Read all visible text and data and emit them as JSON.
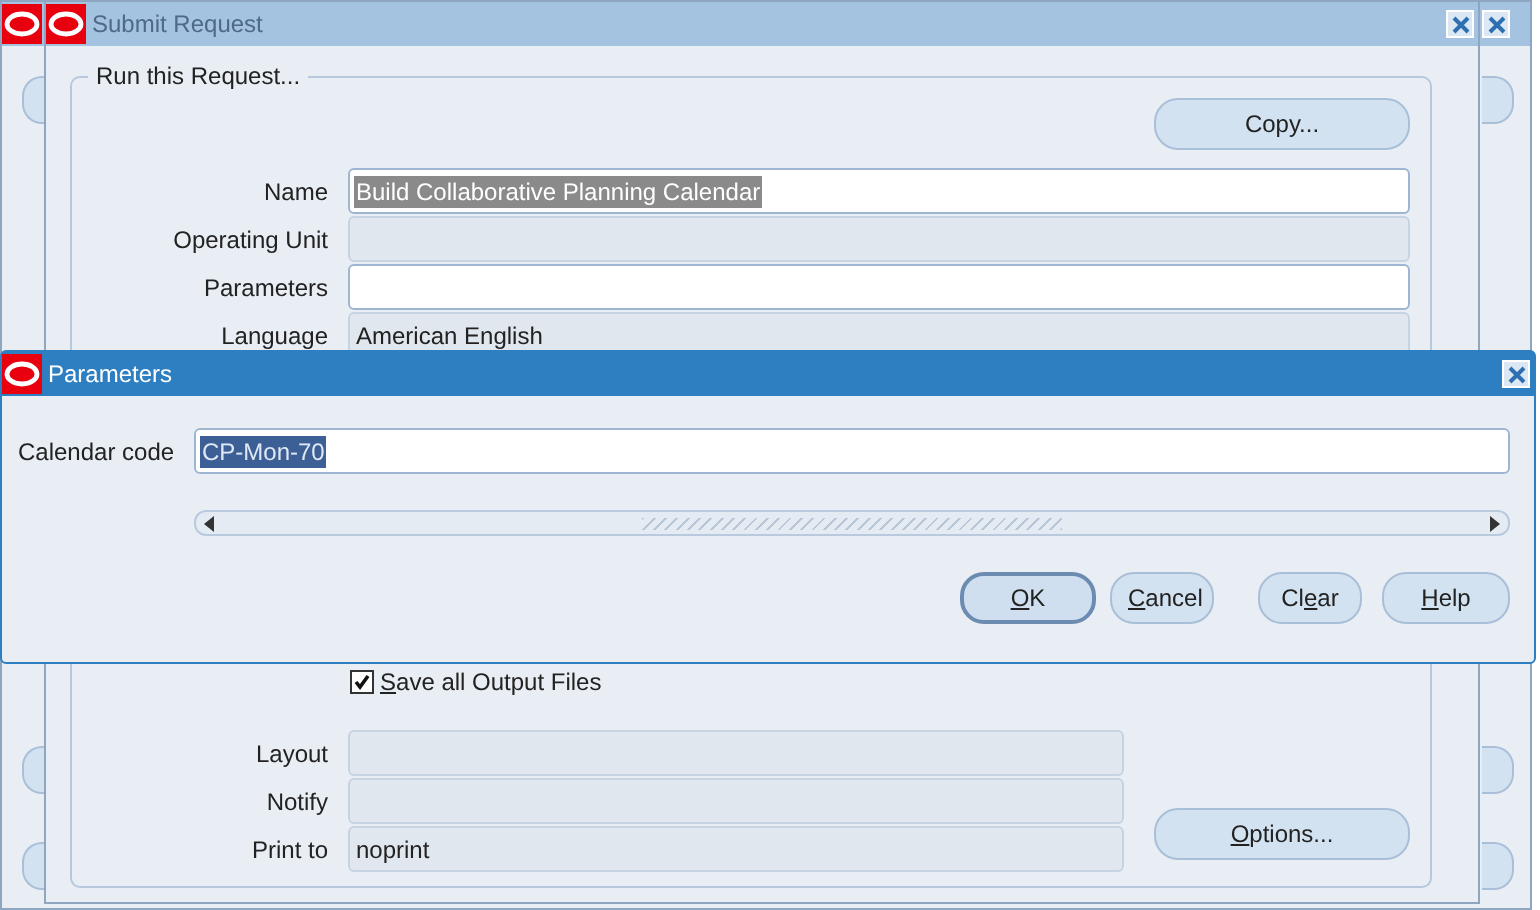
{
  "submit_request": {
    "title": "Submit Request",
    "active": false,
    "group_label": "Run this Request...",
    "copy_button": {
      "label": "Copy..."
    },
    "fields": [
      {
        "label": "Name",
        "value": "Build Collaborative Planning Calendar",
        "editable": true,
        "highlighted": true
      },
      {
        "label": "Operating Unit",
        "editable": false
      },
      {
        "label": "Parameters",
        "editable": true
      },
      {
        "label": "Language",
        "value": "American English",
        "editable": false,
        "highlighted": false
      }
    ],
    "save_output": {
      "label_parts": {
        "underlined": "S",
        "after": "ave all Output Files"
      },
      "checked": true
    },
    "output_fields": [
      {
        "label": "Layout",
        "editable": false
      },
      {
        "label": "Notify",
        "editable": false
      },
      {
        "label": "Print to",
        "value": "noprint",
        "editable": false
      }
    ],
    "options_button": {
      "label_parts": {
        "underlined": "O",
        "after": "ptions..."
      }
    }
  },
  "parameters_dialog": {
    "title": "Parameters",
    "active": true,
    "field": {
      "label": "Calendar code",
      "value": "CP-Mon-70",
      "highlighted": true
    },
    "buttons": [
      {
        "label_parts": {
          "underlined": "O",
          "after": "K"
        },
        "default": true
      },
      {
        "label_parts": {
          "underlined": "C",
          "after": "ancel"
        },
        "default": false
      },
      {
        "label_parts": {
          "before": "Cl",
          "underlined": "e",
          "after": "ar"
        },
        "default": false
      },
      {
        "label_parts": {
          "underlined": "H",
          "after": "elp"
        },
        "default": false
      }
    ]
  }
}
